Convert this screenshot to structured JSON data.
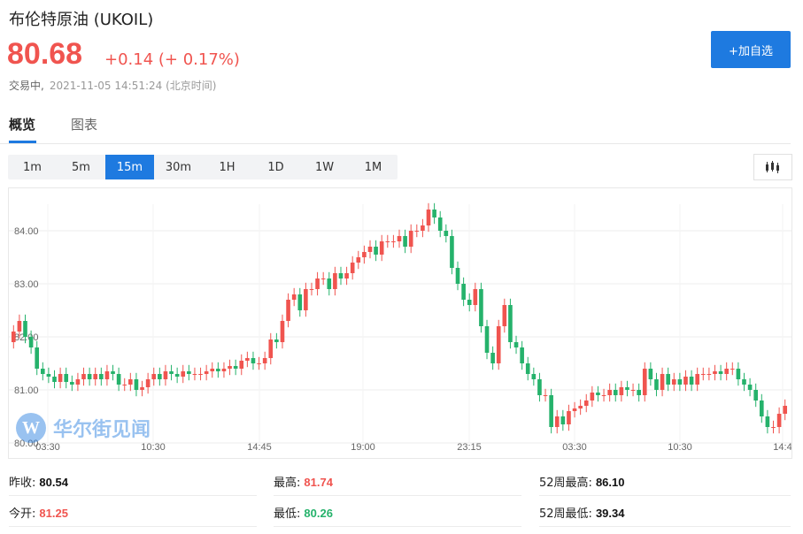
{
  "header": {
    "title": "布伦特原油 (UKOIL)",
    "price": "80.68",
    "change": "+0.14 (+ 0.17%)",
    "status": "交易中,",
    "timestamp": "2021-11-05 14:51:24 (北京时间)",
    "add_label": "+加自选"
  },
  "tabs": [
    "概览",
    "图表"
  ],
  "periods": [
    "1m",
    "5m",
    "15m",
    "30m",
    "1H",
    "1D",
    "1W",
    "1M"
  ],
  "active_period": "15m",
  "watermark": "华尔街见闻",
  "stats": {
    "prev_close_label": "昨收:",
    "prev_close": "80.54",
    "open_label": "今开:",
    "open": "81.25",
    "high_label": "最高:",
    "high": "81.74",
    "low_label": "最低:",
    "low": "80.26",
    "high52_label": "52周最高:",
    "high52": "86.10",
    "low52_label": "52周最低:",
    "low52": "39.34"
  },
  "colors": {
    "up": "#f0544f",
    "down": "#25b26b",
    "accent": "#1e7ae0"
  },
  "chart_data": {
    "type": "candlestick",
    "ylim": [
      80,
      84.5
    ],
    "y_ticks": [
      "80.00",
      "81.00",
      "82.00",
      "83.00",
      "84.00"
    ],
    "x_ticks": [
      "03:30",
      "10:30",
      "14:45",
      "19:00",
      "23:15",
      "03:30",
      "10:30",
      "14:4"
    ],
    "close": [
      82.1,
      82.3,
      82.0,
      81.8,
      81.4,
      81.3,
      81.25,
      81.15,
      81.3,
      81.15,
      81.1,
      81.2,
      81.3,
      81.2,
      81.3,
      81.2,
      81.35,
      81.3,
      81.1,
      81.1,
      81.2,
      81.0,
      81.05,
      81.2,
      81.3,
      81.2,
      81.35,
      81.3,
      81.25,
      81.35,
      81.3,
      81.3,
      81.3,
      81.35,
      81.4,
      81.35,
      81.4,
      81.45,
      81.4,
      81.55,
      81.6,
      81.5,
      81.5,
      81.6,
      81.95,
      81.9,
      82.3,
      82.7,
      82.8,
      82.5,
      82.9,
      82.9,
      83.1,
      83.1,
      82.9,
      83.2,
      83.1,
      83.2,
      83.4,
      83.5,
      83.6,
      83.7,
      83.55,
      83.8,
      83.8,
      83.8,
      83.9,
      83.7,
      84.0,
      84.0,
      84.1,
      84.4,
      84.25,
      84.0,
      83.9,
      83.3,
      83.0,
      82.7,
      82.6,
      82.9,
      82.2,
      81.7,
      81.5,
      82.2,
      82.6,
      81.9,
      81.8,
      81.5,
      81.3,
      81.2,
      80.9,
      80.9,
      80.3,
      80.5,
      80.35,
      80.6,
      80.65,
      80.7,
      80.8,
      80.95,
      80.9,
      80.9,
      81.0,
      80.9,
      81.05,
      81.0,
      81.0,
      80.9,
      81.4,
      81.2,
      81.0,
      81.3,
      81.1,
      81.2,
      81.1,
      81.25,
      81.1,
      81.3,
      81.3,
      81.3,
      81.35,
      81.3,
      81.4,
      81.4,
      81.2,
      81.1,
      81.0,
      80.8,
      80.5,
      80.3,
      80.3,
      80.55,
      80.7
    ],
    "open": [
      81.9,
      82.1,
      82.3,
      82.0,
      81.8,
      81.4,
      81.3,
      81.25,
      81.15,
      81.3,
      81.15,
      81.1,
      81.2,
      81.3,
      81.2,
      81.3,
      81.2,
      81.35,
      81.3,
      81.1,
      81.1,
      81.2,
      81.0,
      81.05,
      81.2,
      81.3,
      81.2,
      81.35,
      81.3,
      81.25,
      81.35,
      81.3,
      81.3,
      81.3,
      81.35,
      81.4,
      81.35,
      81.4,
      81.45,
      81.4,
      81.55,
      81.6,
      81.5,
      81.5,
      81.6,
      81.95,
      81.9,
      82.3,
      82.7,
      82.8,
      82.5,
      82.9,
      82.9,
      83.1,
      83.1,
      82.9,
      83.2,
      83.1,
      83.2,
      83.4,
      83.5,
      83.6,
      83.7,
      83.55,
      83.8,
      83.8,
      83.8,
      83.9,
      83.7,
      84.0,
      84.0,
      84.1,
      84.4,
      84.25,
      84.0,
      83.9,
      83.3,
      83.0,
      82.7,
      82.6,
      82.9,
      82.2,
      81.7,
      81.5,
      82.2,
      82.6,
      81.9,
      81.8,
      81.5,
      81.3,
      81.2,
      80.9,
      80.9,
      80.3,
      80.5,
      80.35,
      80.6,
      80.65,
      80.7,
      80.8,
      80.95,
      80.9,
      80.9,
      81.0,
      80.9,
      81.05,
      81.0,
      81.0,
      80.9,
      81.4,
      81.2,
      81.0,
      81.3,
      81.1,
      81.2,
      81.1,
      81.25,
      81.1,
      81.3,
      81.3,
      81.3,
      81.35,
      81.3,
      81.4,
      81.4,
      81.2,
      81.1,
      81.0,
      80.8,
      80.5,
      80.3,
      80.3,
      80.55
    ]
  }
}
